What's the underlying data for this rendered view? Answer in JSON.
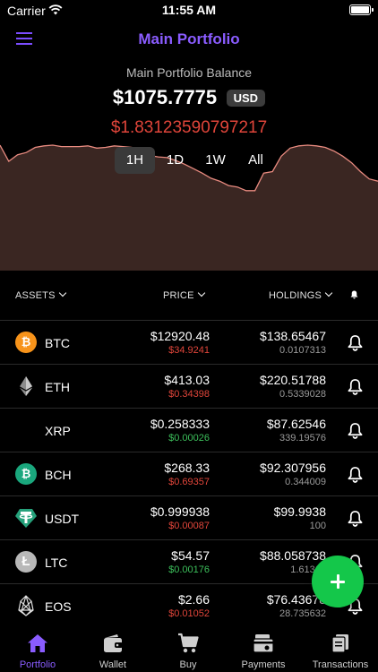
{
  "status_bar": {
    "carrier": "Carrier",
    "time": "11:55 AM"
  },
  "nav": {
    "title": "Main Portfolio",
    "menu_icon": "hamburger-menu-icon"
  },
  "balance": {
    "label": "Main Portfolio Balance",
    "value": "$1075.7775",
    "currency": "USD",
    "change": "$1.83123590797217"
  },
  "chart_data": {
    "type": "area",
    "values": [
      0.0,
      0.22,
      0.13,
      0.1,
      0.03,
      0.01,
      0.0,
      0.02,
      0.02,
      0.02,
      0.01,
      0.04,
      0.03,
      0.01,
      0.02,
      0.03,
      0.08,
      0.14,
      0.16,
      0.17,
      0.21,
      0.26,
      0.32,
      0.38,
      0.45,
      0.49,
      0.55,
      0.57,
      0.62,
      0.62,
      0.38,
      0.36,
      0.15,
      0.04,
      0.01,
      0.0,
      0.01,
      0.03,
      0.08,
      0.15,
      0.24,
      0.36,
      0.46,
      0.49
    ],
    "line_color": "#e98b80",
    "fill_color": "#3a2622"
  },
  "range_tabs": [
    "1H",
    "1D",
    "1W",
    "All"
  ],
  "active_range": "1H",
  "table_header": {
    "assets": "ASSETS",
    "price": "PRICE",
    "holdings": "HOLDINGS"
  },
  "rows": [
    {
      "symbol": "BTC",
      "icon": "bitcoin-icon",
      "price": "$12920.48",
      "change": "$34.9241",
      "change_dir": "neg",
      "holdings": "$138.65467",
      "amount": "0.0107313"
    },
    {
      "symbol": "ETH",
      "icon": "ethereum-icon",
      "price": "$413.03",
      "change": "$0.34398",
      "change_dir": "neg",
      "holdings": "$220.51788",
      "amount": "0.5339028"
    },
    {
      "symbol": "XRP",
      "icon": "xrp-icon",
      "price": "$0.258333",
      "change": "$0.00026",
      "change_dir": "pos",
      "holdings": "$87.62546",
      "amount": "339.19576"
    },
    {
      "symbol": "BCH",
      "icon": "bitcoin-cash-icon",
      "price": "$268.33",
      "change": "$0.69357",
      "change_dir": "neg",
      "holdings": "$92.307956",
      "amount": "0.344009"
    },
    {
      "symbol": "USDT",
      "icon": "tether-icon",
      "price": "$0.999938",
      "change": "$0.00087",
      "change_dir": "neg",
      "holdings": "$99.9938",
      "amount": "100"
    },
    {
      "symbol": "LTC",
      "icon": "litecoin-icon",
      "price": "$54.57",
      "change": "$0.00176",
      "change_dir": "pos",
      "holdings": "$88.058738",
      "amount": "1.61365"
    },
    {
      "symbol": "EOS",
      "icon": "eos-icon",
      "price": "$2.66",
      "change": "$0.01052",
      "change_dir": "neg",
      "holdings": "$76.43678",
      "amount": "28.735632"
    }
  ],
  "colors": {
    "accent": "#8a5cff",
    "negative": "#e0453a",
    "positive": "#3cbf5b",
    "fab": "#14c74a",
    "btc": "#f7931a",
    "bch": "#1aa77d",
    "usdt": "#26a17b",
    "ltc": "#b8b8b8"
  },
  "tabbar": [
    {
      "label": "Portfolio",
      "icon": "home-icon"
    },
    {
      "label": "Wallet",
      "icon": "wallet-icon"
    },
    {
      "label": "Buy",
      "icon": "cart-icon"
    },
    {
      "label": "Payments",
      "icon": "payments-icon"
    },
    {
      "label": "Transactions",
      "icon": "transactions-icon"
    }
  ],
  "active_tab": "Portfolio"
}
